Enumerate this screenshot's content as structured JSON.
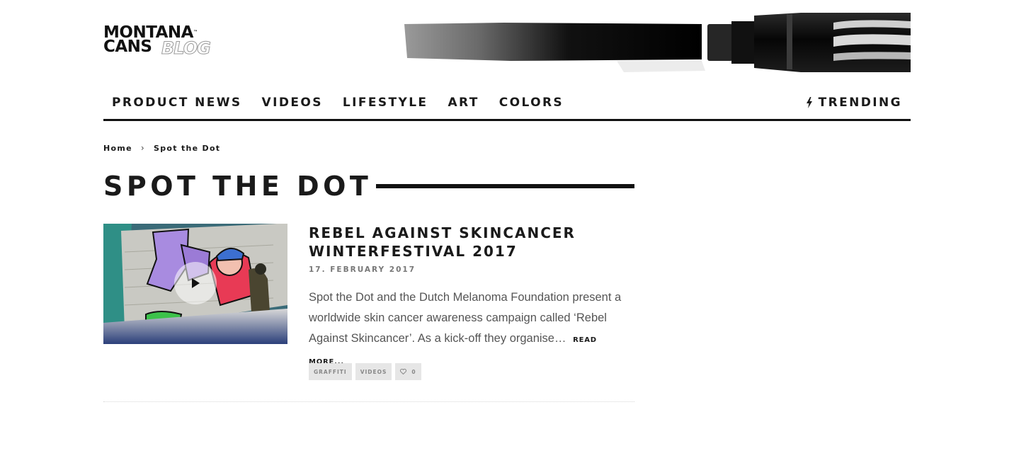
{
  "logo": {
    "line1": "MONTANA",
    "line2": "CANS",
    "tm": "™",
    "suffix": "BLOG"
  },
  "nav": {
    "items": [
      {
        "label": "PRODUCT NEWS"
      },
      {
        "label": "VIDEOS"
      },
      {
        "label": "LIFESTYLE"
      },
      {
        "label": "ART"
      },
      {
        "label": "COLORS"
      }
    ],
    "trending": {
      "label": "TRENDING",
      "icon": "lightning-icon"
    }
  },
  "breadcrumb": {
    "home": "Home",
    "separator": "›",
    "current": "Spot the Dot"
  },
  "page": {
    "title": "SPOT THE DOT"
  },
  "article": {
    "title": "REBEL AGAINST SKINCANCER WINTERFESTIVAL 2017",
    "date": "17. FEBRUARY 2017",
    "excerpt": "Spot the Dot and the Dutch Melanoma Foundation present a worldwide skin cancer awareness campaign called ‘Rebel Against Skincancer’. As a kick-off they organise…",
    "read_more": "READ MORE...",
    "tags": [
      {
        "label": "GRAFFITI"
      },
      {
        "label": "VIDEOS"
      }
    ],
    "likes": "0",
    "thumbnail_icon": "play-icon"
  },
  "colors": {
    "text": "#1a1a1a",
    "muted": "#777777",
    "tag_bg": "#e6e6e6"
  }
}
